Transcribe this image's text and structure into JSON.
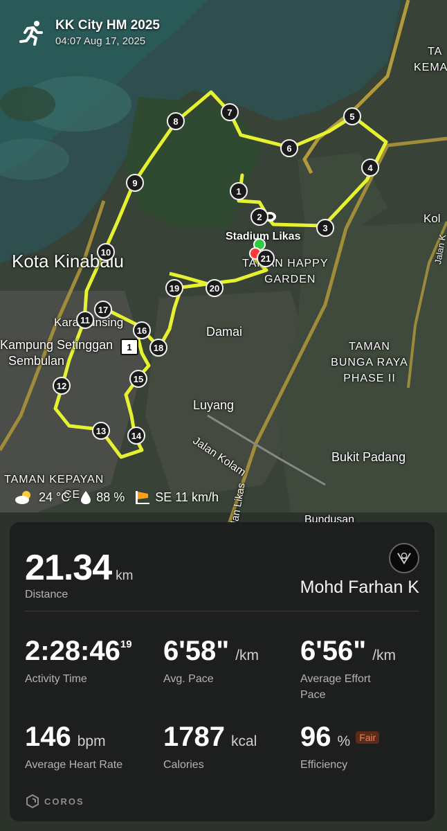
{
  "activity": {
    "title": "KK City HM 2025",
    "datetime": "04:07 Aug 17, 2025"
  },
  "map": {
    "places": {
      "kota_kinabalu": "Kota Kinabalu",
      "stadium_likas": "Stadium Likas",
      "taman_happy": "TAMAN HAPPY",
      "garden": "GARDEN",
      "karamunsing": "Karamunsing",
      "kampung": "Kampung Setinggan",
      "sembulan": "Sembulan",
      "damai": "Damai",
      "luyang": "Luyang",
      "jalan_kolam": "Jalan Kolam",
      "jalan_likas": "Jalan Likas",
      "taman_bunga": "TAMAN",
      "bunga_raya": "BUNGA RAYA",
      "phase": "PHASE II",
      "bukit_padang": "Bukit Padang",
      "taman_kepayan": "TAMAN KEPAYAN",
      "ce": "CE",
      "bundusan": "Bundusan",
      "ta": "TA",
      "kem": "KEMA",
      "kol": "Kol",
      "jalan_k": "Jalan K",
      "road_shield": "1"
    },
    "km_markers": [
      "1",
      "2",
      "3",
      "4",
      "5",
      "6",
      "7",
      "8",
      "9",
      "10",
      "11",
      "12",
      "13",
      "14",
      "15",
      "16",
      "17",
      "18",
      "19",
      "20",
      "21"
    ],
    "route_color": "#e6f230",
    "start_color": "#2ecc40",
    "finish_color": "#ff3b3b"
  },
  "weather": {
    "temperature": "24 °C",
    "humidity": "88 %",
    "wind": "SE 11 km/h"
  },
  "stats": {
    "distance": {
      "value": "21.34",
      "unit": "km",
      "label": "Distance"
    },
    "athlete": "Mohd Farhan K",
    "activity_time": {
      "value": "2:28:46",
      "sup": "19",
      "label": "Activity Time"
    },
    "avg_pace": {
      "value": "6'58\"",
      "unit": "/km",
      "label": "Avg. Pace"
    },
    "effort_pace": {
      "value": "6'56\"",
      "unit": "/km",
      "label_1": "Average Effort",
      "label_2": "Pace"
    },
    "heart_rate": {
      "value": "146",
      "unit": "bpm",
      "label": "Average Heart Rate"
    },
    "calories": {
      "value": "1787",
      "unit": "kcal",
      "label": "Calories"
    },
    "efficiency": {
      "value": "96",
      "unit": "%",
      "badge": "Fair",
      "label": "Efficiency"
    }
  },
  "brand": "COROS"
}
